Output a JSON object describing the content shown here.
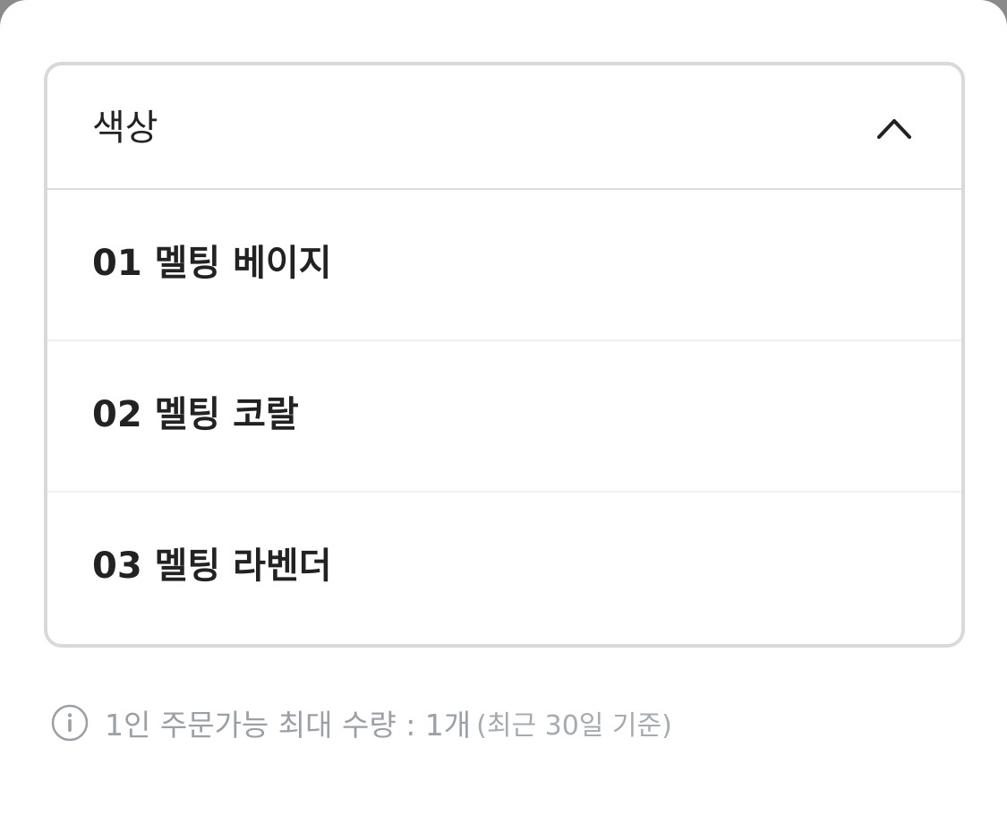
{
  "dropdown": {
    "label": "색상",
    "options": [
      {
        "label": "01 멜팅 베이지"
      },
      {
        "label": "02 멜팅 코랄"
      },
      {
        "label": "03 멜팅 라벤더"
      }
    ]
  },
  "notice": {
    "main": "1인 주문가능 최대 수량 : 1개",
    "sub": "(최근 30일 기준)"
  },
  "icons": {
    "header": "chevron-up-icon",
    "notice": "info-icon"
  }
}
